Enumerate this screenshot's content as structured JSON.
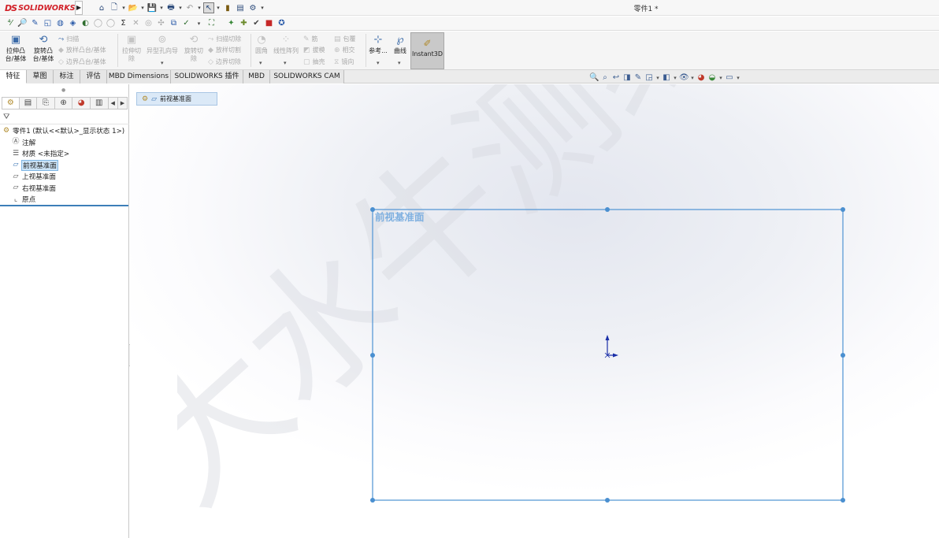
{
  "app": {
    "logo_mark": "DS",
    "logo_text": "SOLIDWORKS",
    "document_title": "零件1 *"
  },
  "quick_access": {
    "icons": [
      "home-icon",
      "new-document-icon",
      "open-icon",
      "save-icon",
      "print-icon",
      "undo-icon",
      "select-icon",
      "rebuild-icon",
      "file-properties-icon",
      "options-icon"
    ]
  },
  "command_manager": {
    "extrude_boss": "拉伸凸\n台/基体",
    "revolve_boss": "旋转凸\n台/基体",
    "sweep": "扫描",
    "loft": "放样凸台/基体",
    "boundary_boss": "边界凸台/基体",
    "extrude_cut": "拉伸切\n除",
    "hole_wizard": "异型孔向导",
    "revolve_cut": "旋转切\n除",
    "swept_cut": "扫描切除",
    "lofted_cut": "放样切割",
    "boundary_cut": "边界切除",
    "fillet": "圆角",
    "linear_pattern": "线性阵列",
    "rib": "筋",
    "draft": "拔模",
    "shell": "抽壳",
    "wrap": "包覆",
    "intersect": "相交",
    "mirror": "镜向",
    "reference": "参考...",
    "curves": "曲线",
    "instant3d": "Instant3D"
  },
  "tabs": [
    {
      "label": "特征"
    },
    {
      "label": "草图"
    },
    {
      "label": "标注"
    },
    {
      "label": "评估"
    },
    {
      "label": "MBD Dimensions"
    },
    {
      "label": "SOLIDWORKS 插件"
    },
    {
      "label": "MBD"
    },
    {
      "label": "SOLIDWORKS CAM"
    }
  ],
  "feature_tree": {
    "root": "零件1 (默认<<默认>_显示状态 1>)",
    "items": [
      {
        "label": "注解",
        "icon": "annotations-icon"
      },
      {
        "label": "材质 <未指定>",
        "icon": "material-icon"
      },
      {
        "label": "前视基准面",
        "icon": "plane-icon",
        "selected": true
      },
      {
        "label": "上视基准面",
        "icon": "plane-icon"
      },
      {
        "label": "右视基准面",
        "icon": "plane-icon"
      },
      {
        "label": "原点",
        "icon": "origin-icon"
      }
    ]
  },
  "graphics": {
    "breadcrumb_label": "前视基准面",
    "plane_label": "前视基准面",
    "watermark": "大水牛测绘",
    "accent_color": "#4a8fd0",
    "plane_color": "#5a9ad6",
    "origin_color": "#1a2fa8"
  }
}
